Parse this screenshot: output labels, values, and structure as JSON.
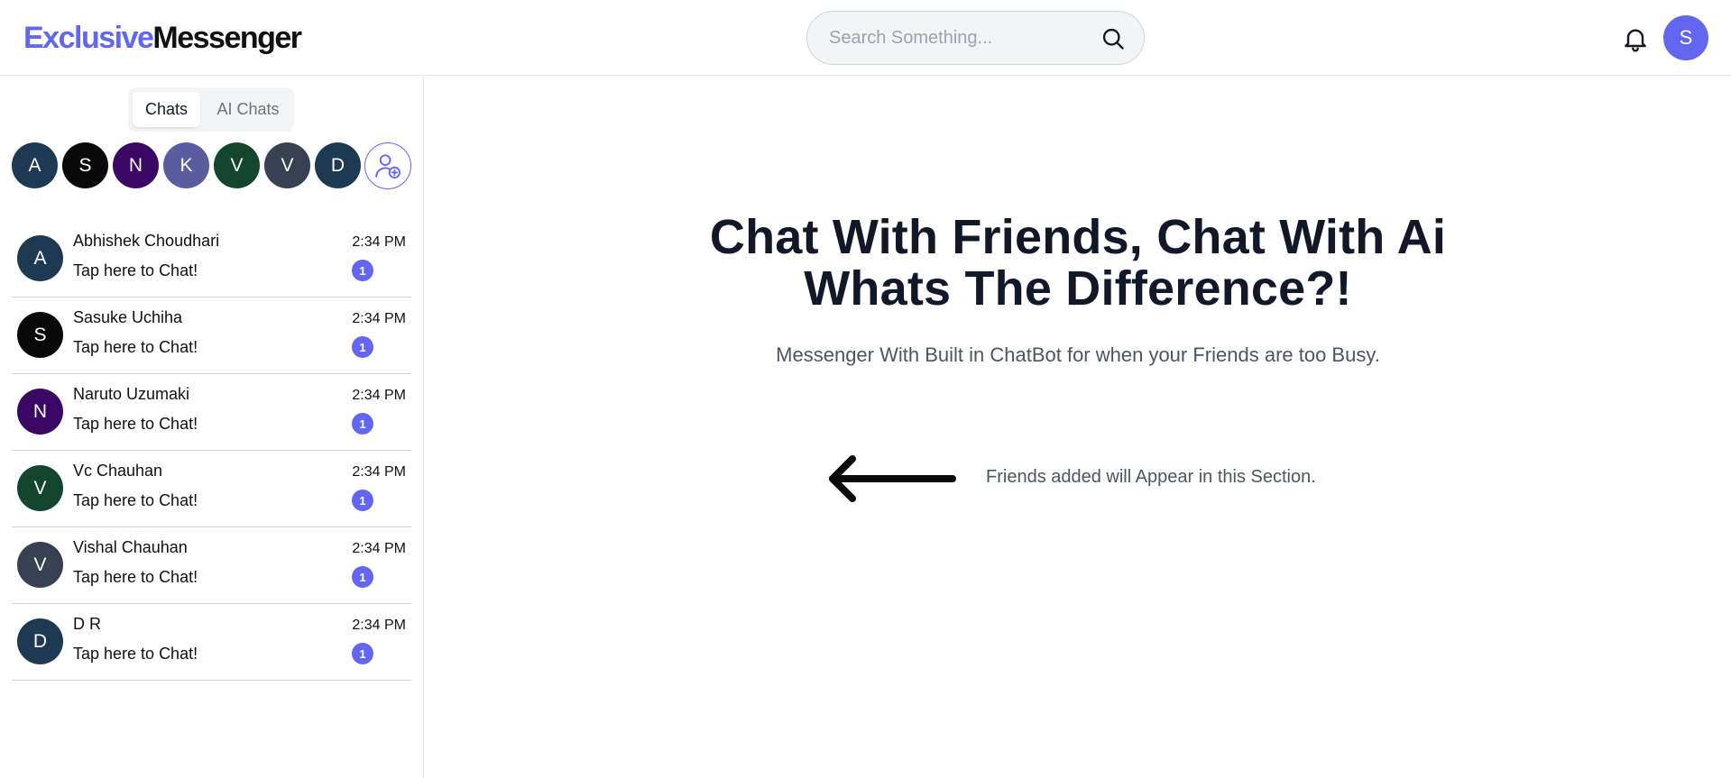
{
  "header": {
    "logo_part1": "Exclusive",
    "logo_part2": "Messenger",
    "search_placeholder": "Search Something...",
    "user_initial": "S"
  },
  "sidebar": {
    "tabs": [
      {
        "label": "Chats"
      },
      {
        "label": "AI Chats"
      }
    ],
    "stories": [
      {
        "initial": "A",
        "color": "#1e3a52"
      },
      {
        "initial": "S",
        "color": "#0a0a0a"
      },
      {
        "initial": "N",
        "color": "#3b0764"
      },
      {
        "initial": "K",
        "color": "#5b5b9f"
      },
      {
        "initial": "V",
        "color": "#14462f"
      },
      {
        "initial": "V",
        "color": "#374151"
      },
      {
        "initial": "D",
        "color": "#1e3a52"
      }
    ],
    "chats": [
      {
        "initial": "A",
        "color": "#1e3a52",
        "name": "Abhishek Choudhari",
        "preview": "Tap here to Chat!",
        "time": "2:34 PM",
        "unread": "1"
      },
      {
        "initial": "S",
        "color": "#0a0a0a",
        "name": "Sasuke Uchiha",
        "preview": "Tap here to Chat!",
        "time": "2:34 PM",
        "unread": "1"
      },
      {
        "initial": "N",
        "color": "#3b0764",
        "name": "Naruto Uzumaki",
        "preview": "Tap here to Chat!",
        "time": "2:34 PM",
        "unread": "1"
      },
      {
        "initial": "V",
        "color": "#14462f",
        "name": "Vc Chauhan",
        "preview": "Tap here to Chat!",
        "time": "2:34 PM",
        "unread": "1"
      },
      {
        "initial": "V",
        "color": "#374151",
        "name": "Vishal Chauhan",
        "preview": "Tap here to Chat!",
        "time": "2:34 PM",
        "unread": "1"
      },
      {
        "initial": "D",
        "color": "#1e3a52",
        "name": "D R",
        "preview": "Tap here to Chat!",
        "time": "2:34 PM",
        "unread": "1"
      }
    ]
  },
  "main": {
    "title_line1": "Chat With Friends, Chat With Ai",
    "title_line2": "Whats The Difference?!",
    "subtitle": "Messenger With Built in ChatBot for when your Friends are too Busy.",
    "hint": "Friends added will Appear in this Section."
  },
  "colors": {
    "accent": "#6366f1",
    "border": "#e5e7eb"
  },
  "icons": [
    "search-icon",
    "bell-icon",
    "add-friend-icon",
    "arrow-left-icon"
  ]
}
